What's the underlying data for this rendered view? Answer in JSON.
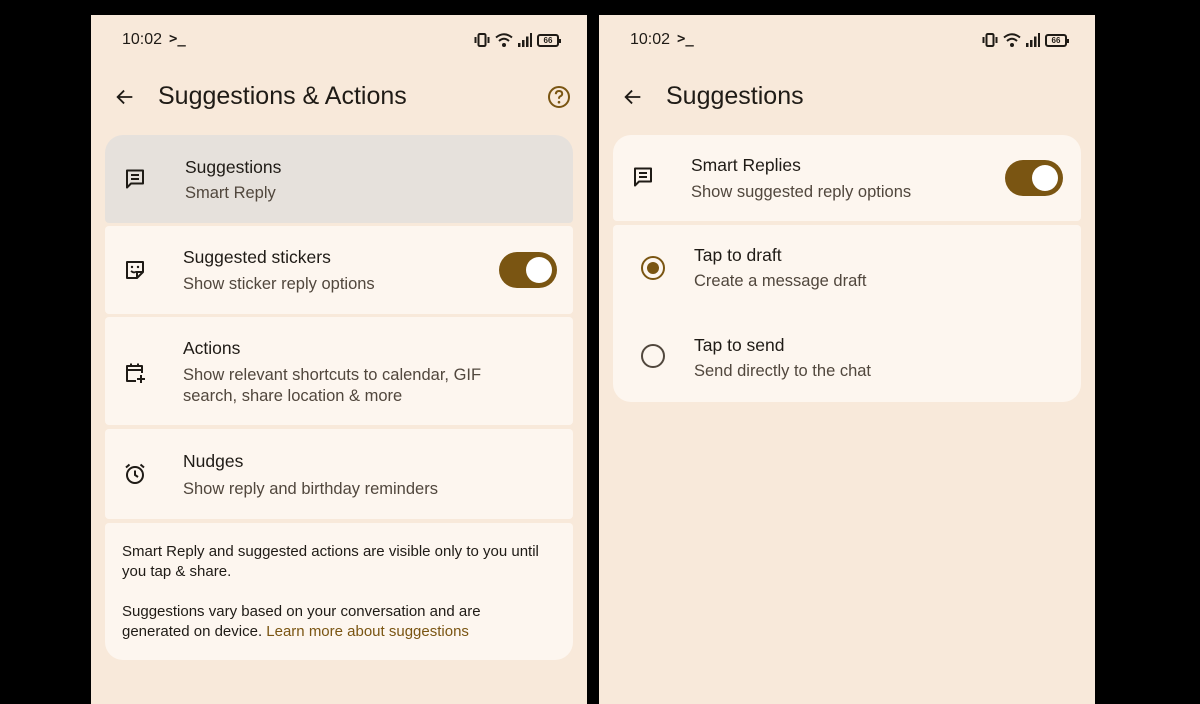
{
  "left_screen": {
    "status": {
      "time": "10:02",
      "terminal": ">_",
      "battery": "66"
    },
    "title": "Suggestions & Actions",
    "rows": [
      {
        "title": "Suggestions",
        "subtitle": "Smart Reply"
      },
      {
        "title": "Suggested stickers",
        "subtitle": "Show sticker reply options",
        "toggle_on": true
      },
      {
        "title": "Actions",
        "subtitle": "Show relevant shortcuts to calendar, GIF search, share location & more"
      },
      {
        "title": "Nudges",
        "subtitle": "Show reply and birthday reminders"
      }
    ],
    "footer": {
      "para1": "Smart Reply and suggested actions are visible only to you until you tap & share.",
      "para2": "Suggestions vary based on your conversation and are generated on device.",
      "link": "Learn more about suggestions"
    }
  },
  "right_screen": {
    "status": {
      "time": "10:02",
      "terminal": ">_",
      "battery": "66"
    },
    "title": "Suggestions",
    "smart_replies": {
      "title": "Smart Replies",
      "subtitle": "Show suggested reply options",
      "toggle_on": true
    },
    "options": [
      {
        "title": "Tap to draft",
        "subtitle": "Create a message draft",
        "selected": true
      },
      {
        "title": "Tap to send",
        "subtitle": "Send directly to the chat",
        "selected": false
      }
    ]
  },
  "colors": {
    "background": "#f8e9da",
    "card": "#fdf6ef",
    "highlight": "#e6e1dc",
    "accent": "#7a5512",
    "text": "#1f1b16",
    "secondary_text": "#51473d"
  },
  "icons": {
    "status": [
      "vibrate-icon",
      "wifi-icon",
      "signal-icon",
      "battery-icon"
    ],
    "left_rows": [
      "message-icon",
      "sticker-icon",
      "calendar-add-icon",
      "alarm-icon"
    ],
    "right_rows": [
      "message-icon"
    ],
    "navigation": [
      "back-arrow-icon",
      "help-icon"
    ]
  }
}
